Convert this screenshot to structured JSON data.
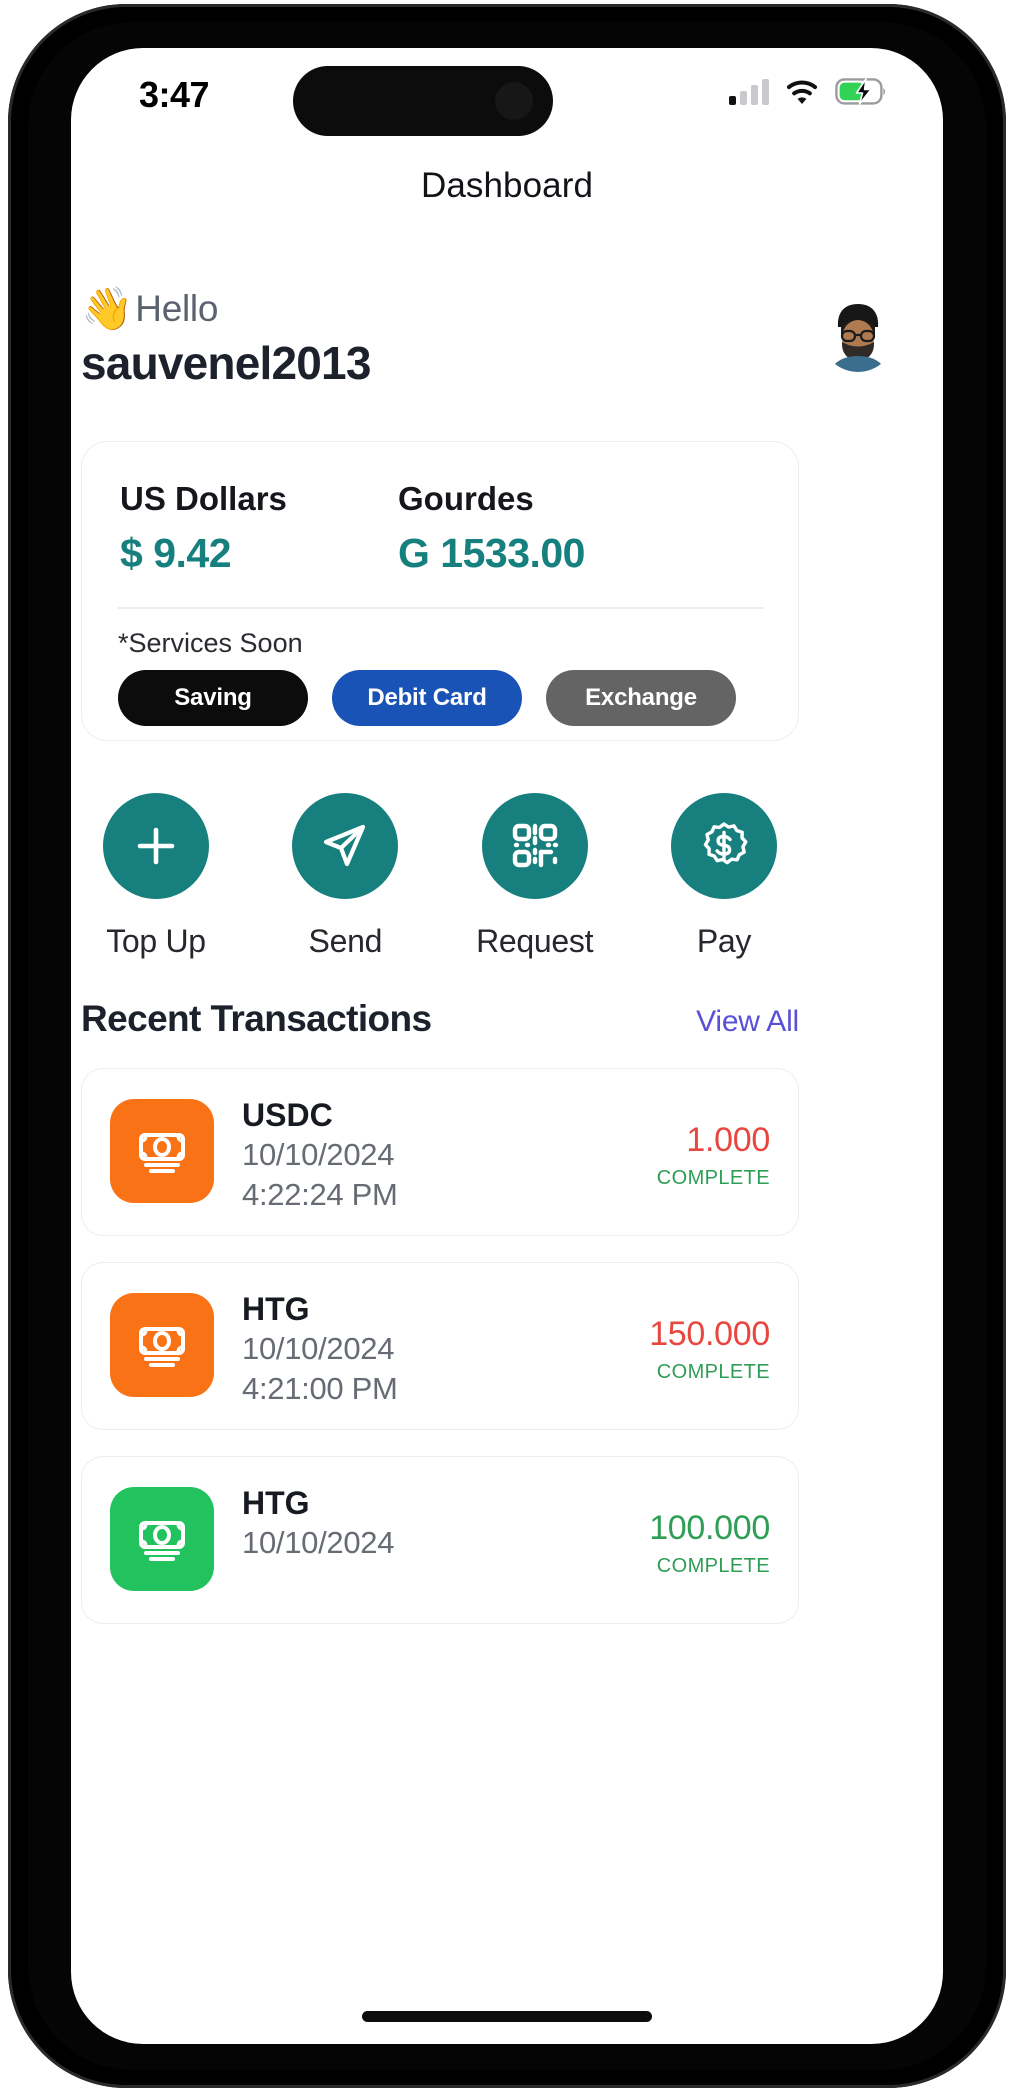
{
  "status_bar": {
    "time": "3:47",
    "signal_icon": "cellular-signal-icon",
    "wifi_icon": "wifi-icon",
    "battery_icon": "battery-charging-icon",
    "battery_color": "#32d257"
  },
  "header": {
    "title": "Dashboard"
  },
  "greeting": {
    "wave_emoji": "👋",
    "hello_label": "Hello",
    "username": "sauvenel2013",
    "avatar_name": "user-avatar"
  },
  "balance_card": {
    "currencies": [
      {
        "label": "US  Dollars",
        "value": "$ 9.42"
      },
      {
        "label": "Gourdes",
        "value": "G 1533.00"
      }
    ],
    "value_color": "#15807e",
    "services_note": "*Services Soon",
    "service_buttons": [
      {
        "label": "Saving",
        "color": "#0c0c0c"
      },
      {
        "label": "Debit Card",
        "color": "#1a53b6"
      },
      {
        "label": "Exchange",
        "color": "#646464"
      }
    ]
  },
  "quick_actions": {
    "circle_color": "#17807e",
    "items": [
      {
        "label": "Top Up",
        "icon": "plus-icon"
      },
      {
        "label": "Send",
        "icon": "paper-plane-icon"
      },
      {
        "label": "Request",
        "icon": "qr-code-icon"
      },
      {
        "label": "Pay",
        "icon": "dollar-badge-icon"
      }
    ]
  },
  "recent_transactions": {
    "title": "Recent Transactions",
    "view_all_label": "View All",
    "view_all_color": "#5a50d6",
    "items": [
      {
        "ticker": "USDC",
        "date": "10/10/2024",
        "time": "4:22:24 PM",
        "amount": "1.000",
        "amount_color": "#e8473f",
        "status": "COMPLETE",
        "icon": "banknote-icon",
        "icon_bg": "#f97316"
      },
      {
        "ticker": "HTG",
        "date": "10/10/2024",
        "time": "4:21:00 PM",
        "amount": "150.000",
        "amount_color": "#e8473f",
        "status": "COMPLETE",
        "icon": "banknote-icon",
        "icon_bg": "#f97316"
      },
      {
        "ticker": "HTG",
        "date": "10/10/2024",
        "time": "",
        "amount": "100.000",
        "amount_color": "#2e9e55",
        "status": "COMPLETE",
        "icon": "banknote-icon",
        "icon_bg": "#22c35e"
      }
    ]
  }
}
